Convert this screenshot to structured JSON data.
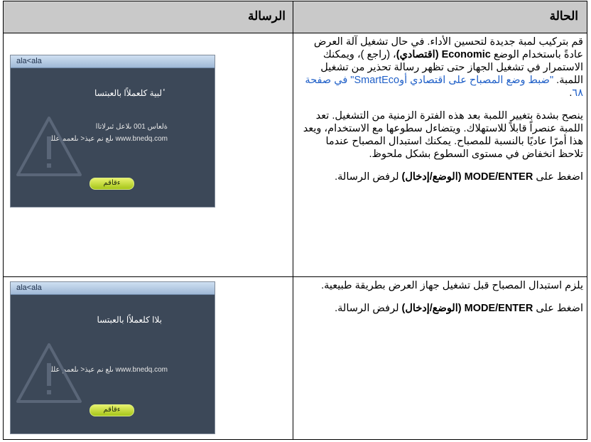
{
  "table": {
    "header": {
      "status": "الحالة",
      "message": "الرسالة"
    },
    "rows": [
      {
        "p1_a": "قم بتركيب لمبة جديدة لتحسين الأداء. في حال تشغيل آلة العرض عادةً باستخدام الوضع ",
        "p1_mode": "Economic (اقتصادي)",
        "p1_b": "، (راجع )، ويمكنك الاستمرار في تشغيل الجهاز حتى تظهر رسالة تحذير من تشغيل اللمبة. ",
        "p1_link": "\"ضبط وضع المصباح على اقتصادي أوSmartEco\" في صفحة ٦٨",
        "p1_end": ".",
        "p2": "ينصح بشدة بتغيير اللمبة بعد هذه الفترة الزمنية من التشغيل. تعد اللمبة عنصراً قابلاً للاستهلاك. ويتضاءل سطوعها مع الاستخدام، ويعد هذا أمرًا عاديًا بالنسبة للمصباح. يمكنك استبدال المصباح عندما تلاحظ انخفاض في مستوى السطوع بشكل ملحوظ.",
        "p3_a": "اضغط على ",
        "p3_bold": "MODE/ENTER (الوضع/إدخال)",
        "p3_b": " لرفض الرسالة.",
        "osd": {
          "title": "ala<ala",
          "heading": "ٔلبية كلعملاًا بالعبتسا",
          "line1": "ةلعاس 001 ىلاعل ئىرلاتاا",
          "line2": "www.bnedq.com ىلع نم عيذ< ىلعمم علله",
          "button": "ءقاقم"
        }
      },
      {
        "p1": "يلزم استبدال المصباح قبل تشغيل جهاز العرض بطريقة طبيعية.",
        "p2_a": "اضغط على ",
        "p2_bold": "MODE/ENTER (الوضع/إدخال)",
        "p2_b": " لرفض الرسالة.",
        "osd": {
          "title": "ala<ala",
          "heading": "بلاا كلعملاًا بالعبتسا",
          "line1": "www.bnedq.com ىلع نم عيذ< ىلعمم علله",
          "button": "ءقاقم"
        }
      }
    ]
  },
  "colors": {
    "header_bg": "#c9c9c9",
    "link": "#2060c8",
    "osd_bg": "#3c4858",
    "osd_button": "#c8dc3c"
  },
  "icons": [
    "warning-triangle-icon"
  ]
}
